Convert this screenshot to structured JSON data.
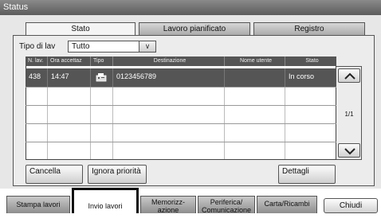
{
  "window": {
    "title": "Status"
  },
  "tabs": [
    "Stato",
    "Lavoro pianificato",
    "Registro"
  ],
  "filter": {
    "label": "Tipo di lav",
    "value": "Tutto"
  },
  "table": {
    "headers": [
      "N. lav.",
      "Ora accettaz",
      "Tipo",
      "Destinazione",
      "Nome utente",
      "Stato"
    ],
    "rows": [
      {
        "job_no": "438",
        "time": "14:47",
        "type_icon": "fax-icon",
        "destination": "0123456789",
        "user": "",
        "status": "In corso"
      }
    ]
  },
  "pager": {
    "page": "1/1"
  },
  "actions": {
    "cancel": "Cancella",
    "ignore_priority": "Ignora priorità",
    "details": "Dettagli"
  },
  "bottom_tabs": [
    "Stampa lavori",
    "Invio lavori",
    "Memorizz-azione",
    "Periferica/ Comunicazione",
    "Carta/Ricambi"
  ],
  "close_label": "Chiudi",
  "colors": {
    "header_bg": "#555555",
    "selected_row_bg": "#555555",
    "titlebar_bg": "#6e6e6e"
  }
}
